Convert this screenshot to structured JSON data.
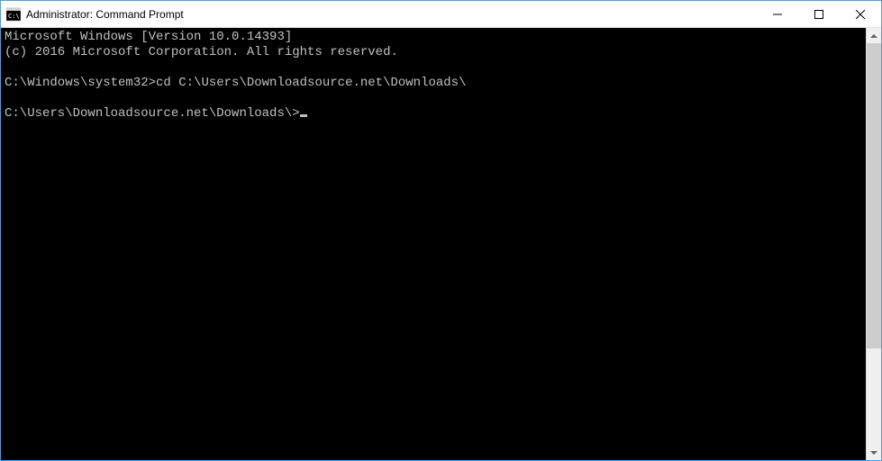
{
  "titlebar": {
    "title": "Administrator: Command Prompt"
  },
  "terminal": {
    "line1": "Microsoft Windows [Version 10.0.14393]",
    "line2": "(c) 2016 Microsoft Corporation. All rights reserved.",
    "prompt1": "C:\\Windows\\system32>",
    "command1": "cd C:\\Users\\Downloadsource.net\\Downloads\\",
    "prompt2": "C:\\Users\\Downloadsource.net\\Downloads\\>"
  }
}
